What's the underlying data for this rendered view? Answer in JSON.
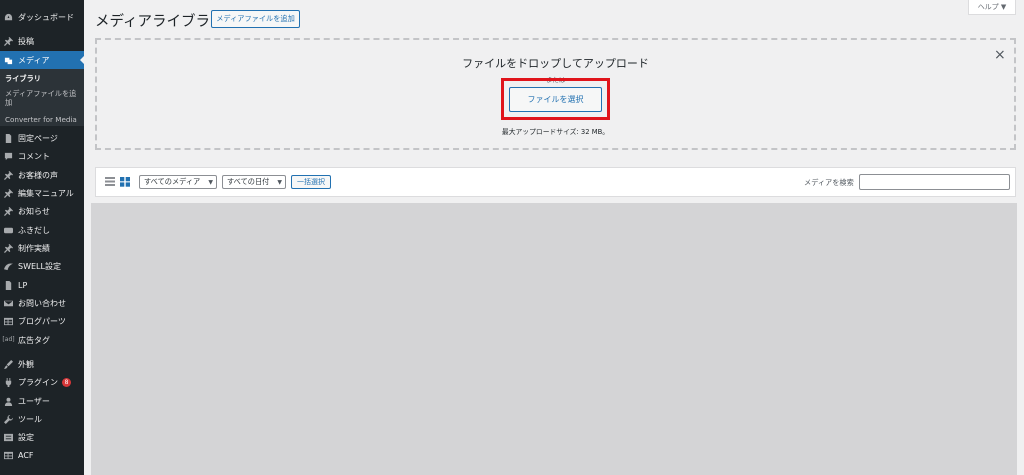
{
  "sidebar": {
    "items": [
      {
        "label": "ダッシュボード",
        "icon": "dashboard-icon"
      },
      {
        "label": "投稿",
        "icon": "pin-icon"
      },
      {
        "label": "メディア",
        "icon": "media-icon"
      },
      {
        "label": "固定ページ",
        "icon": "page-icon"
      },
      {
        "label": "コメント",
        "icon": "comment-icon"
      },
      {
        "label": "お客様の声",
        "icon": "pin-icon"
      },
      {
        "label": "編集マニュアル",
        "icon": "pin-icon"
      },
      {
        "label": "お知らせ",
        "icon": "pin-icon"
      },
      {
        "label": "ふきだし",
        "icon": "balloon-icon"
      },
      {
        "label": "制作実績",
        "icon": "pin-icon"
      },
      {
        "label": "SWELL設定",
        "icon": "swell-icon"
      },
      {
        "label": "LP",
        "icon": "page-icon"
      },
      {
        "label": "お問い合わせ",
        "icon": "mail-icon"
      },
      {
        "label": "ブログパーツ",
        "icon": "table-icon"
      },
      {
        "label": "広告タグ",
        "icon": "ad-icon",
        "glyph": "[ad]"
      },
      {
        "label": "外観",
        "icon": "brush-icon"
      },
      {
        "label": "プラグイン",
        "icon": "plugin-icon",
        "badge": "8"
      },
      {
        "label": "ユーザー",
        "icon": "user-icon"
      },
      {
        "label": "ツール",
        "icon": "wrench-icon"
      },
      {
        "label": "設定",
        "icon": "settings-icon"
      },
      {
        "label": "ACF",
        "icon": "table-icon"
      }
    ],
    "submenu": {
      "library": "ライブラリ",
      "add_new": "メディアファイルを追加",
      "converter": "Converter for Media"
    }
  },
  "header": {
    "title": "メディアライブラリ",
    "add_button": "メディアファイルを追加",
    "help": "ヘルプ ▼"
  },
  "uploader": {
    "drop_text": "ファイルをドロップしてアップロード",
    "or_text": "または",
    "select_button": "ファイルを選択",
    "max_size": "最大アップロードサイズ: 32 MB。",
    "close": "×"
  },
  "toolbar": {
    "media_filter": "すべてのメディア",
    "date_filter": "すべての日付",
    "bulk_select": "一括選択",
    "search_label": "メディアを検索",
    "search_value": ""
  },
  "colors": {
    "sidebar_bg": "#1d2327",
    "accent": "#2271b1",
    "highlight_frame": "#e0141b",
    "badge": "#d63638"
  }
}
